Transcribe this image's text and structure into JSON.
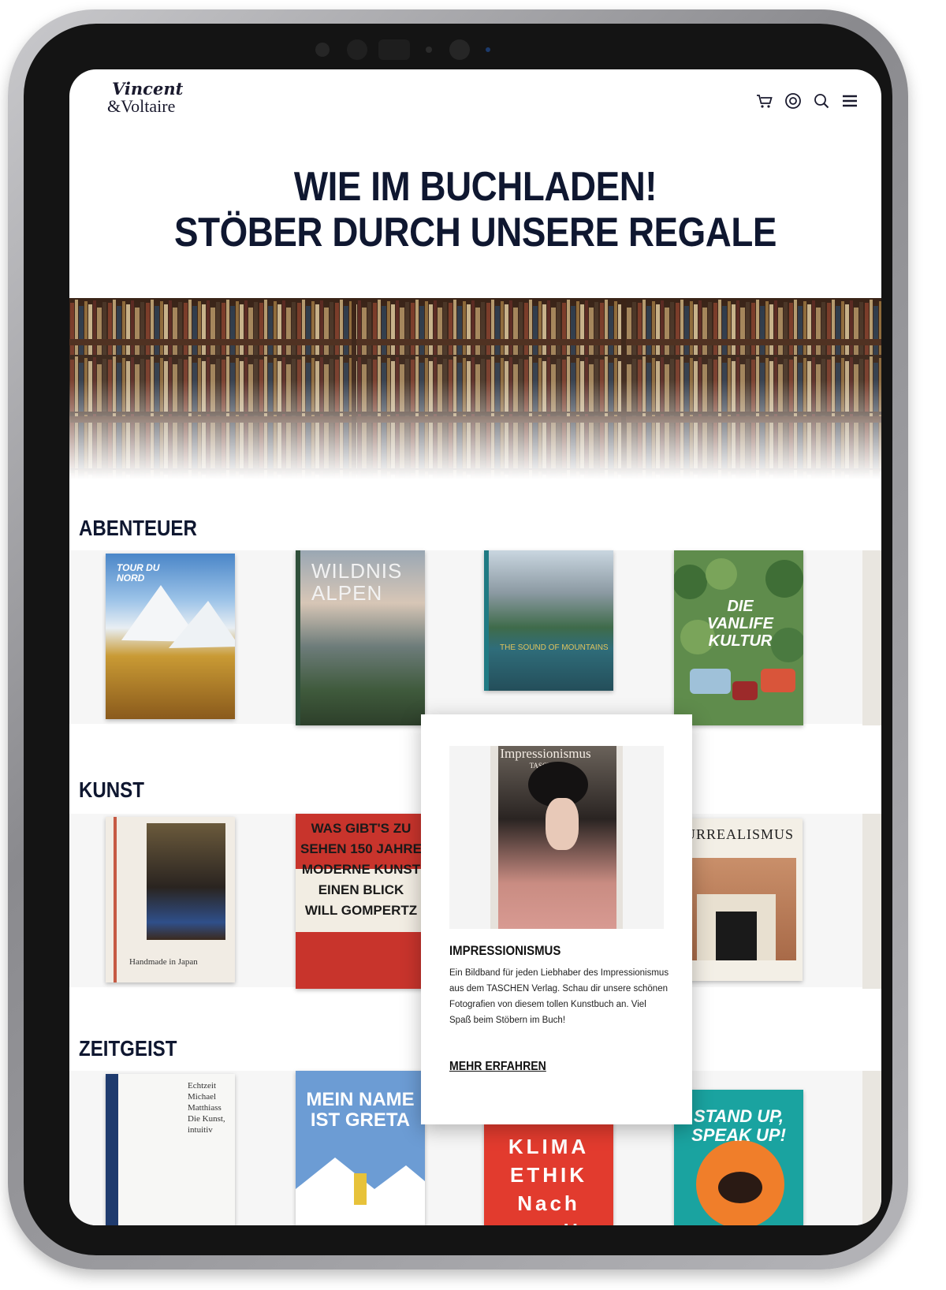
{
  "header": {
    "logo_line1": "Vincent",
    "logo_line2": "&Voltaire",
    "icons": [
      "cart-icon",
      "account-icon",
      "search-icon",
      "menu-icon"
    ]
  },
  "hero": {
    "line1": "WIE IM BUCHLADEN!",
    "line2": "STÖBER DURCH UNSERE REGALE"
  },
  "sections": [
    {
      "title": "ABENTEUER",
      "books": [
        {
          "title_text": "TOUR DU NORD"
        },
        {
          "title_text": "WILDNIS ALPEN"
        },
        {
          "title_text": "THE SOUND OF MOUNTAINS"
        },
        {
          "title_text": "DIE VANLIFE KULTUR"
        }
      ]
    },
    {
      "title": "KUNST",
      "books": [
        {
          "title_text": "Handmade in Japan"
        },
        {
          "title_text": "WAS GIBT'S ZU SEHEN 150 JAHRE MODERNE KUNST EINEN BLICK WILL GOMPERTZ"
        },
        {
          "title_text": "SURREALISMUS"
        }
      ]
    },
    {
      "title": "ZEITGEIST",
      "books": [
        {
          "title_text": "Echtzeit Michael Matthiass Die Kunst, intuitiv"
        },
        {
          "title_text": "MEIN NAME IST GRETA"
        },
        {
          "title_text": "KLIMA ETHIK Nach uns die Sintflut?"
        },
        {
          "title_text": "STAND UP, SPEAK UP!"
        }
      ]
    }
  ],
  "popup": {
    "cover_title": "Impressionismus",
    "heading": "IMPRESSIONISMUS",
    "description": "Ein Bildband für jeden Liebhaber des Impressionismus aus dem TASCHEN Verlag. Schau dir unsere schönen Fotografien von diesem tollen Kunstbuch an. Viel Spaß beim Stöbern im Buch!",
    "link_label": "MEHR ERFAHREN",
    "publisher": "TASCHEN"
  }
}
